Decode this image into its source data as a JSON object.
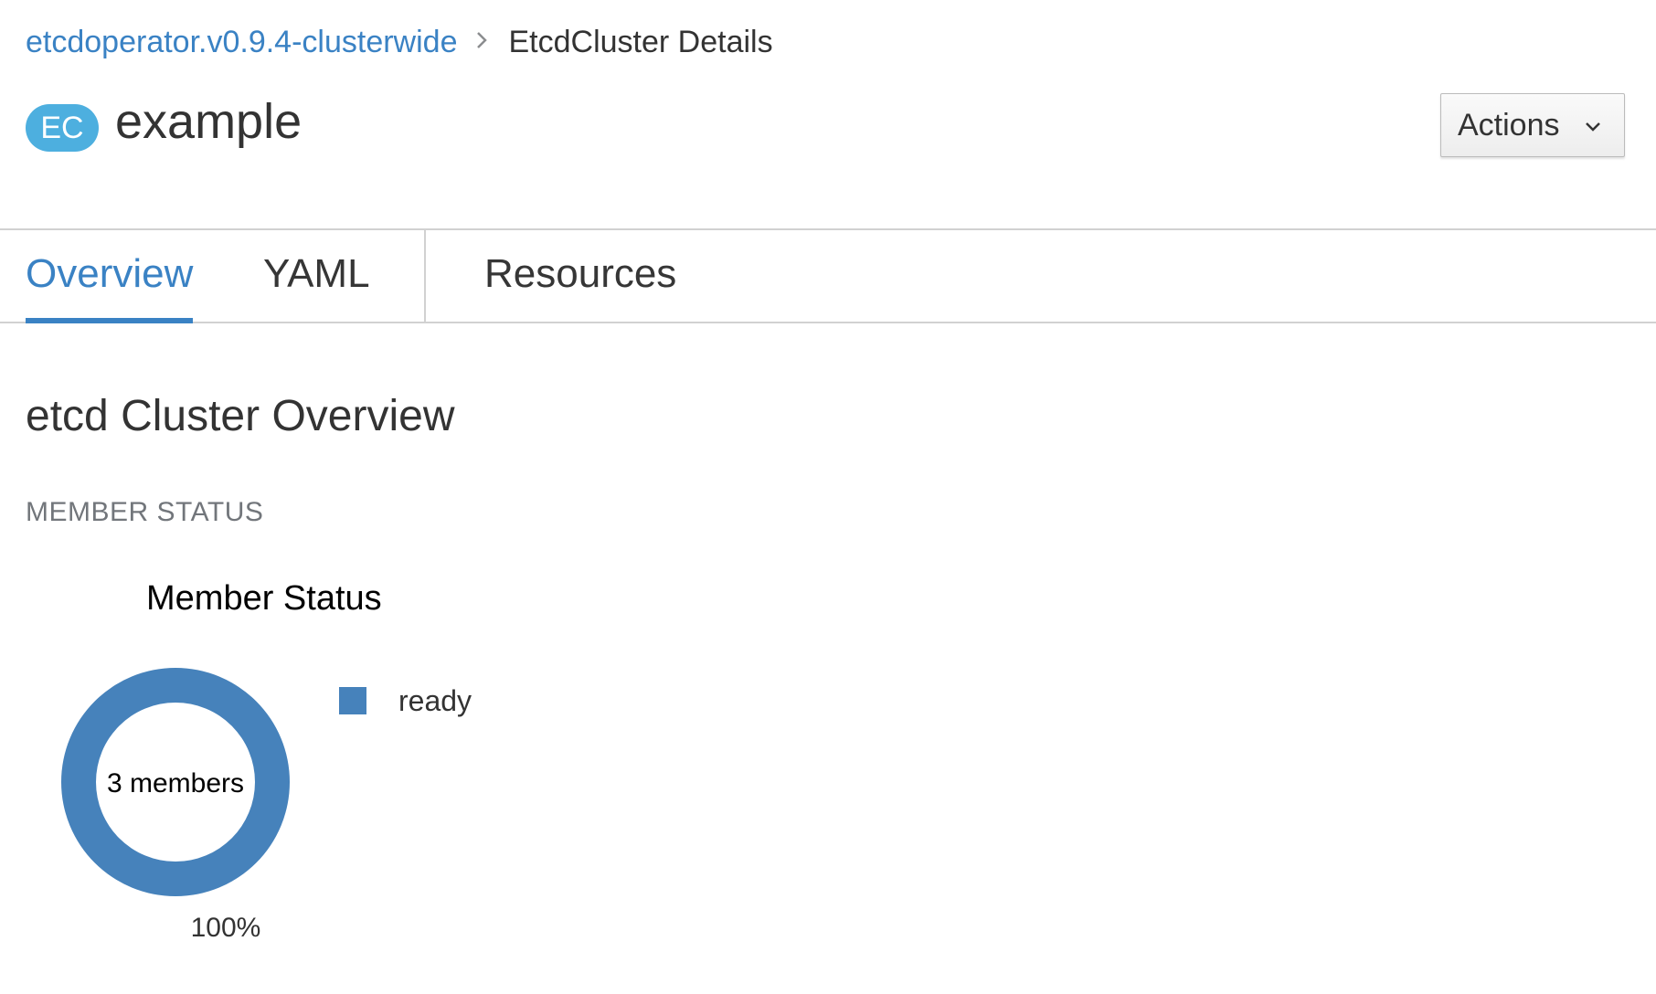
{
  "breadcrumb": {
    "parent": "etcdoperator.v0.9.4-clusterwide",
    "current": "EtcdCluster Details"
  },
  "header": {
    "badge": "EC",
    "title": "example",
    "actions_label": "Actions",
    "actions_icon": "chevron-down-icon"
  },
  "tabs": [
    {
      "label": "Overview",
      "active": true
    },
    {
      "label": "YAML",
      "active": false
    },
    {
      "label": "Resources",
      "active": false
    }
  ],
  "overview": {
    "title": "etcd Cluster Overview",
    "subheading": "MEMBER STATUS"
  },
  "colors": {
    "link": "#3a82c4",
    "badge": "#4dafdf",
    "ready": "#4682bb"
  },
  "chart_data": {
    "type": "pie",
    "title": "Member Status",
    "center_label": "3 members",
    "categories": [
      "ready"
    ],
    "values": [
      100
    ],
    "value_labels": [
      "100%"
    ],
    "colors": [
      "#4682bb"
    ],
    "legend": "right"
  }
}
